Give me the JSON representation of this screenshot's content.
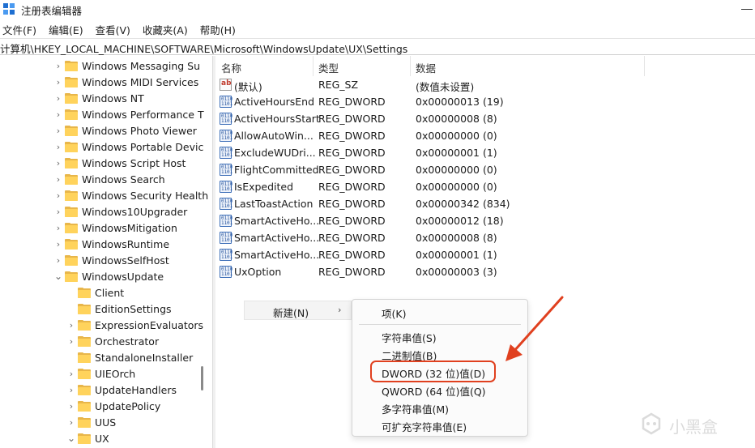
{
  "window": {
    "title": "注册表编辑器"
  },
  "menu": [
    "文件(F)",
    "编辑(E)",
    "查看(V)",
    "收藏夹(A)",
    "帮助(H)"
  ],
  "address": "计算机\\HKEY_LOCAL_MACHINE\\SOFTWARE\\Microsoft\\WindowsUpdate\\UX\\Settings",
  "tree": [
    {
      "label": "Windows Messaging Su",
      "expander": "collapsed",
      "indent": 0
    },
    {
      "label": "Windows MIDI Services",
      "expander": "collapsed",
      "indent": 0
    },
    {
      "label": "Windows NT",
      "expander": "collapsed",
      "indent": 0
    },
    {
      "label": "Windows Performance T",
      "expander": "collapsed",
      "indent": 0
    },
    {
      "label": "Windows Photo Viewer",
      "expander": "collapsed",
      "indent": 0
    },
    {
      "label": "Windows Portable Devic",
      "expander": "collapsed",
      "indent": 0
    },
    {
      "label": "Windows Script Host",
      "expander": "collapsed",
      "indent": 0
    },
    {
      "label": "Windows Search",
      "expander": "collapsed",
      "indent": 0
    },
    {
      "label": "Windows Security Health",
      "expander": "collapsed",
      "indent": 0
    },
    {
      "label": "Windows10Upgrader",
      "expander": "collapsed",
      "indent": 0
    },
    {
      "label": "WindowsMitigation",
      "expander": "collapsed",
      "indent": 0
    },
    {
      "label": "WindowsRuntime",
      "expander": "collapsed",
      "indent": 0
    },
    {
      "label": "WindowsSelfHost",
      "expander": "collapsed",
      "indent": 0
    },
    {
      "label": "WindowsUpdate",
      "expander": "expanded",
      "indent": 0
    },
    {
      "label": "Client",
      "expander": "none",
      "indent": 1
    },
    {
      "label": "EditionSettings",
      "expander": "none",
      "indent": 1
    },
    {
      "label": "ExpressionEvaluators",
      "expander": "collapsed",
      "indent": 1
    },
    {
      "label": "Orchestrator",
      "expander": "collapsed",
      "indent": 1
    },
    {
      "label": "StandaloneInstaller",
      "expander": "none",
      "indent": 1
    },
    {
      "label": "UIEOrch",
      "expander": "collapsed",
      "indent": 1
    },
    {
      "label": "UpdateHandlers",
      "expander": "collapsed",
      "indent": 1
    },
    {
      "label": "UpdatePolicy",
      "expander": "collapsed",
      "indent": 1
    },
    {
      "label": "UUS",
      "expander": "collapsed",
      "indent": 1
    },
    {
      "label": "UX",
      "expander": "expanded",
      "indent": 1
    }
  ],
  "columns": {
    "name": "名称",
    "type": "类型",
    "data": "数据"
  },
  "values": [
    {
      "name": "(默认)",
      "type": "REG_SZ",
      "data": "(数值未设置)",
      "icon": "string-value-icon"
    },
    {
      "name": "ActiveHoursEnd",
      "type": "REG_DWORD",
      "data": "0x00000013 (19)",
      "icon": "dword-value-icon"
    },
    {
      "name": "ActiveHoursStart",
      "type": "REG_DWORD",
      "data": "0x00000008 (8)",
      "icon": "dword-value-icon"
    },
    {
      "name": "AllowAutoWin...",
      "type": "REG_DWORD",
      "data": "0x00000000 (0)",
      "icon": "dword-value-icon"
    },
    {
      "name": "ExcludeWUDri...",
      "type": "REG_DWORD",
      "data": "0x00000001 (1)",
      "icon": "dword-value-icon"
    },
    {
      "name": "FlightCommitted",
      "type": "REG_DWORD",
      "data": "0x00000000 (0)",
      "icon": "dword-value-icon"
    },
    {
      "name": "IsExpedited",
      "type": "REG_DWORD",
      "data": "0x00000000 (0)",
      "icon": "dword-value-icon"
    },
    {
      "name": "LastToastAction",
      "type": "REG_DWORD",
      "data": "0x00000342 (834)",
      "icon": "dword-value-icon"
    },
    {
      "name": "SmartActiveHo...",
      "type": "REG_DWORD",
      "data": "0x00000012 (18)",
      "icon": "dword-value-icon"
    },
    {
      "name": "SmartActiveHo...",
      "type": "REG_DWORD",
      "data": "0x00000008 (8)",
      "icon": "dword-value-icon"
    },
    {
      "name": "SmartActiveHo...",
      "type": "REG_DWORD",
      "data": "0x00000001 (1)",
      "icon": "dword-value-icon"
    },
    {
      "name": "UxOption",
      "type": "REG_DWORD",
      "data": "0x00000003 (3)",
      "icon": "dword-value-icon"
    }
  ],
  "context_menu": {
    "new_label": "新建(N)",
    "arrow": "›"
  },
  "submenu": {
    "key": "项(K)",
    "items": [
      "字符串值(S)",
      "二进制值(B)",
      "DWORD (32 位)值(D)",
      "QWORD (64 位)值(Q)",
      "多字符串值(M)",
      "可扩充字符串值(E)"
    ]
  },
  "watermark": "小黑盒",
  "colors": {
    "highlight": "#e0401f",
    "folder": "#ffd35c",
    "arrow": "#e0401f"
  }
}
